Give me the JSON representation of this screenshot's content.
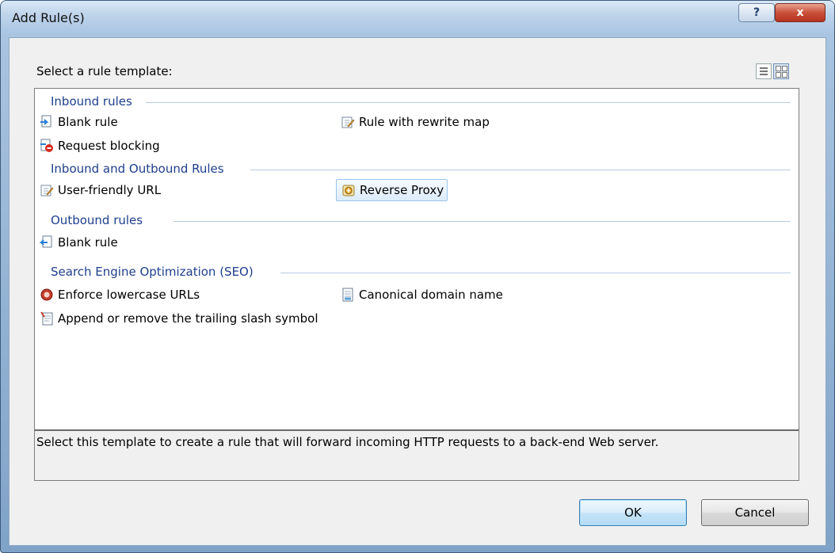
{
  "window": {
    "title": "Add Rule(s)"
  },
  "titlebar": {
    "help_label": "?",
    "close_label": "x"
  },
  "prompt": "Select a rule template:",
  "view_toggle": {
    "list_icon": "list-view-icon",
    "tile_icon": "tile-view-icon"
  },
  "groups": [
    {
      "label": "Inbound rules",
      "items": [
        {
          "label": "Blank rule",
          "icon": "blank-inbound-rule-icon"
        },
        {
          "label": "Rule with rewrite map",
          "icon": "rewrite-map-icon"
        },
        {
          "label": "Request blocking",
          "icon": "request-blocking-icon"
        }
      ]
    },
    {
      "label": "Inbound and Outbound Rules",
      "items": [
        {
          "label": "User-friendly URL",
          "icon": "user-friendly-url-icon"
        },
        {
          "label": "Reverse Proxy",
          "icon": "reverse-proxy-icon",
          "selected": true
        }
      ]
    },
    {
      "label": "Outbound rules",
      "items": [
        {
          "label": "Blank rule",
          "icon": "blank-outbound-rule-icon"
        }
      ]
    },
    {
      "label": "Search Engine Optimization (SEO)",
      "items": [
        {
          "label": "Enforce lowercase URLs",
          "icon": "lowercase-urls-icon"
        },
        {
          "label": "Canonical domain name",
          "icon": "canonical-domain-icon"
        },
        {
          "label": "Append or remove the trailing slash symbol",
          "icon": "trailing-slash-icon"
        }
      ]
    }
  ],
  "description": "Select this template to create a rule that will forward incoming HTTP requests to a back-end Web server.",
  "buttons": {
    "ok": "OK",
    "cancel": "Cancel"
  },
  "colors": {
    "group_header": "#1e3f8c",
    "selection": "#dcecfb",
    "close": "#c9503a"
  }
}
